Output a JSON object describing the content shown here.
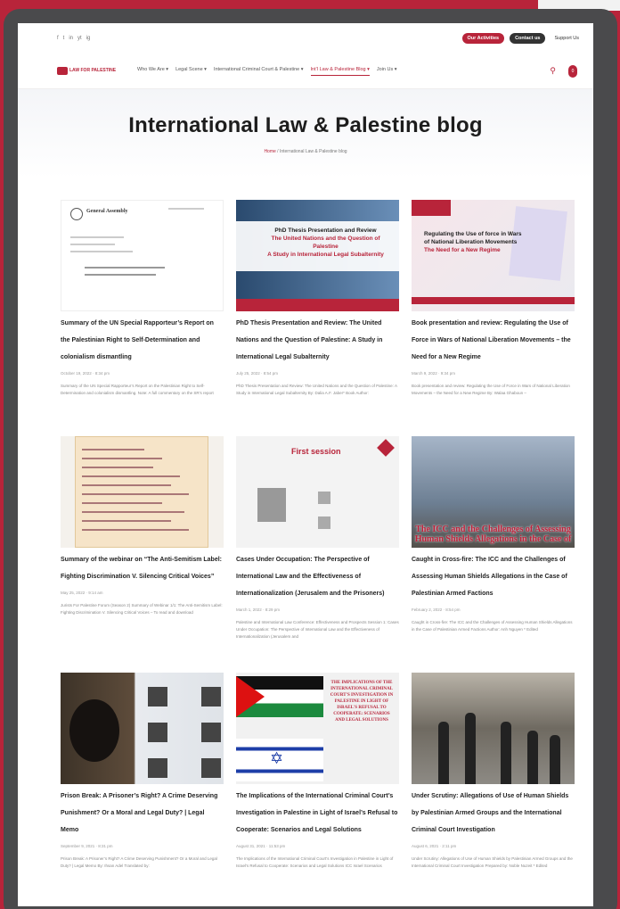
{
  "site": {
    "socials": [
      "f",
      "t",
      "in",
      "yt",
      "ig"
    ],
    "top_buttons": [
      "Our Activities",
      "Contact us"
    ],
    "support": "Support Us",
    "logo": "LAW FOR PALESTINE",
    "menu": [
      "Who We Are ▾",
      "Legal Scene ▾",
      "International Criminal Court & Palestine ▾",
      "Int’l Law & Palestine Blog ▾",
      "Join Us ▾"
    ],
    "cart_count": "0"
  },
  "hero": {
    "title": "International Law & Palestine blog",
    "crumb_home": "Home",
    "crumb_rest": " / International Law & Palestine blog"
  },
  "posts": [
    {
      "title": "Summary of the UN Special Rapporteur’s Report on the Palestinian Right to Self-Determination and colonialism dismantling",
      "date": "October 19, 2022 · 8:34 pm",
      "excerpt": "Summary of the UN Special Rapporteur’s Report on the Palestinian Right to Self-Determination and colonialism dismantling. Note: A full commentary on the SR’s report"
    },
    {
      "title": "PhD Thesis Presentation and Review: The United Nations and the Question of Palestine: A Study in International Legal Subalternity",
      "date": "July 25, 2022 · 8:54 pm",
      "excerpt": "PhD Thesis Presentation and Review: The United Nations and the Question of Palestine: A Study in International Legal Subalternity By: Dalia A.F. Jaber* Book Author:"
    },
    {
      "title": "Book presentation and review: Regulating the Use of Force in Wars of National Liberation Movements – the Need for a New Regime",
      "date": "March 9, 2022 · 9:34 pm",
      "excerpt": "Book presentation and review: Regulating the Use of Force in Wars of National Liberation Movements – the Need for a New Regime By: Walaa Ghaboun –"
    },
    {
      "title": "Summary of the webinar on “The Anti-Semitism Label: Fighting Discrimination V. Silencing Critical Voices”",
      "date": "May 25, 2022 · 9:14 am",
      "excerpt": "Jurists For Palestine Forum (Season 2) Summary of Webinar 1/1: The Anti-Semitism Label: Fighting Discrimination V. Silencing Critical Voices – To read and download"
    },
    {
      "title": "Cases Under Occupation: The Perspective of International Law and the Effectiveness of Internationalization (Jerusalem and the Prisoners)",
      "date": "March 1, 2022 · 8:29 pm",
      "excerpt": "Palestine and International Law Conference: Effectiveness and Prospects Session 1: Cases Under Occupation: The Perspective of International Law and the Effectiveness of Internationalization (Jerusalem and"
    },
    {
      "title": "Caught in Cross-fire: The ICC and the Challenges of Assessing Human Shields Allegations in the Case of Palestinian Armed Factions",
      "date": "February 2, 2022 · 8:54 pm",
      "excerpt": "Caught in Cross-fire: The ICC and the Challenges of Assessing Human Shields Allegations in the Case of Palestinian Armed Factions Author: Anh Nguyen * Edited"
    },
    {
      "title": "Prison Break: A Prisoner’s Right? A Crime Deserving Punishment? Or a Moral and Legal Duty? | Legal Memo",
      "date": "September 9, 2021 · 8:31 pm",
      "excerpt": "Prison Break: A Prisoner’s Right? A Crime Deserving Punishment? Or a Moral and Legal Duty? | Legal Memo By: Ihsan Adel Translated by:"
    },
    {
      "title": "The Implications of the International Criminal Court’s Investigation in Palestine in Light of Israel’s Refusal to Cooperate: Scenarios and Legal Solutions",
      "date": "August 31, 2021 · 11:53 pm",
      "excerpt": "The Implications of the International Criminal Court’s Investigation in Palestine in Light of Israel’s Refusal to Cooperate: Scenarios and Legal Solutions ICC Israel Scenarios"
    },
    {
      "title": "Under Scrutiny: Allegations of Use of Human Shields by Palestinian Armed Groups and the International Criminal Court Investigation",
      "date": "August 6, 2021 · 2:11 pm",
      "excerpt": "Under Scrutiny: Allegations of Use of Human Shields by Palestinian Armed Groups and the International Criminal Court Investigation Prepared by: Noble Nuzeit * Edited"
    }
  ],
  "thumbs": {
    "doc_header": "General Assembly",
    "phd_heading": "PhD Thesis Presentation and Review",
    "phd_subtitle": "The United Nations and the Question of Palestine",
    "phd_study": "A Study in International Legal Subalternity",
    "book_line1": "Regulating the Use of force in Wars of National Liberation Movements",
    "book_line2": "The Need for a New Regime",
    "session_title": "First session",
    "icc_text": "The ICC and the Challenges of Assessing Human Shields Allegations in the Case of",
    "impl_text": "THE IMPLICATIONS OF THE INTERNATIONAL CRIMINAL COURT'S INVESTIGATION IN PALESTINE IN LIGHT OF ISRAEL'S REFUSAL TO COOPERATE: SCENARIOS AND LEGAL SOLUTIONS"
  },
  "colors": {
    "brand": "#b8243a",
    "frame": "#4a4a4c"
  }
}
